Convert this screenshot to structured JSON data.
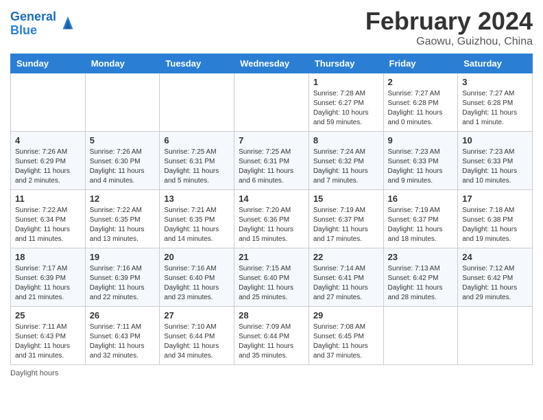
{
  "header": {
    "logo_line1": "General",
    "logo_line2": "Blue",
    "month": "February 2024",
    "location": "Gaowu, Guizhou, China"
  },
  "days_of_week": [
    "Sunday",
    "Monday",
    "Tuesday",
    "Wednesday",
    "Thursday",
    "Friday",
    "Saturday"
  ],
  "weeks": [
    [
      {
        "day": "",
        "info": ""
      },
      {
        "day": "",
        "info": ""
      },
      {
        "day": "",
        "info": ""
      },
      {
        "day": "",
        "info": ""
      },
      {
        "day": "1",
        "info": "Sunrise: 7:28 AM\nSunset: 6:27 PM\nDaylight: 10 hours\nand 59 minutes."
      },
      {
        "day": "2",
        "info": "Sunrise: 7:27 AM\nSunset: 6:28 PM\nDaylight: 11 hours\nand 0 minutes."
      },
      {
        "day": "3",
        "info": "Sunrise: 7:27 AM\nSunset: 6:28 PM\nDaylight: 11 hours\nand 1 minute."
      }
    ],
    [
      {
        "day": "4",
        "info": "Sunrise: 7:26 AM\nSunset: 6:29 PM\nDaylight: 11 hours\nand 2 minutes."
      },
      {
        "day": "5",
        "info": "Sunrise: 7:26 AM\nSunset: 6:30 PM\nDaylight: 11 hours\nand 4 minutes."
      },
      {
        "day": "6",
        "info": "Sunrise: 7:25 AM\nSunset: 6:31 PM\nDaylight: 11 hours\nand 5 minutes."
      },
      {
        "day": "7",
        "info": "Sunrise: 7:25 AM\nSunset: 6:31 PM\nDaylight: 11 hours\nand 6 minutes."
      },
      {
        "day": "8",
        "info": "Sunrise: 7:24 AM\nSunset: 6:32 PM\nDaylight: 11 hours\nand 7 minutes."
      },
      {
        "day": "9",
        "info": "Sunrise: 7:23 AM\nSunset: 6:33 PM\nDaylight: 11 hours\nand 9 minutes."
      },
      {
        "day": "10",
        "info": "Sunrise: 7:23 AM\nSunset: 6:33 PM\nDaylight: 11 hours\nand 10 minutes."
      }
    ],
    [
      {
        "day": "11",
        "info": "Sunrise: 7:22 AM\nSunset: 6:34 PM\nDaylight: 11 hours\nand 11 minutes."
      },
      {
        "day": "12",
        "info": "Sunrise: 7:22 AM\nSunset: 6:35 PM\nDaylight: 11 hours\nand 13 minutes."
      },
      {
        "day": "13",
        "info": "Sunrise: 7:21 AM\nSunset: 6:35 PM\nDaylight: 11 hours\nand 14 minutes."
      },
      {
        "day": "14",
        "info": "Sunrise: 7:20 AM\nSunset: 6:36 PM\nDaylight: 11 hours\nand 15 minutes."
      },
      {
        "day": "15",
        "info": "Sunrise: 7:19 AM\nSunset: 6:37 PM\nDaylight: 11 hours\nand 17 minutes."
      },
      {
        "day": "16",
        "info": "Sunrise: 7:19 AM\nSunset: 6:37 PM\nDaylight: 11 hours\nand 18 minutes."
      },
      {
        "day": "17",
        "info": "Sunrise: 7:18 AM\nSunset: 6:38 PM\nDaylight: 11 hours\nand 19 minutes."
      }
    ],
    [
      {
        "day": "18",
        "info": "Sunrise: 7:17 AM\nSunset: 6:39 PM\nDaylight: 11 hours\nand 21 minutes."
      },
      {
        "day": "19",
        "info": "Sunrise: 7:16 AM\nSunset: 6:39 PM\nDaylight: 11 hours\nand 22 minutes."
      },
      {
        "day": "20",
        "info": "Sunrise: 7:16 AM\nSunset: 6:40 PM\nDaylight: 11 hours\nand 23 minutes."
      },
      {
        "day": "21",
        "info": "Sunrise: 7:15 AM\nSunset: 6:40 PM\nDaylight: 11 hours\nand 25 minutes."
      },
      {
        "day": "22",
        "info": "Sunrise: 7:14 AM\nSunset: 6:41 PM\nDaylight: 11 hours\nand 27 minutes."
      },
      {
        "day": "23",
        "info": "Sunrise: 7:13 AM\nSunset: 6:42 PM\nDaylight: 11 hours\nand 28 minutes."
      },
      {
        "day": "24",
        "info": "Sunrise: 7:12 AM\nSunset: 6:42 PM\nDaylight: 11 hours\nand 29 minutes."
      }
    ],
    [
      {
        "day": "25",
        "info": "Sunrise: 7:11 AM\nSunset: 6:43 PM\nDaylight: 11 hours\nand 31 minutes."
      },
      {
        "day": "26",
        "info": "Sunrise: 7:11 AM\nSunset: 6:43 PM\nDaylight: 11 hours\nand 32 minutes."
      },
      {
        "day": "27",
        "info": "Sunrise: 7:10 AM\nSunset: 6:44 PM\nDaylight: 11 hours\nand 34 minutes."
      },
      {
        "day": "28",
        "info": "Sunrise: 7:09 AM\nSunset: 6:44 PM\nDaylight: 11 hours\nand 35 minutes."
      },
      {
        "day": "29",
        "info": "Sunrise: 7:08 AM\nSunset: 6:45 PM\nDaylight: 11 hours\nand 37 minutes."
      },
      {
        "day": "",
        "info": ""
      },
      {
        "day": "",
        "info": ""
      }
    ]
  ],
  "footer": {
    "note": "Daylight hours"
  }
}
